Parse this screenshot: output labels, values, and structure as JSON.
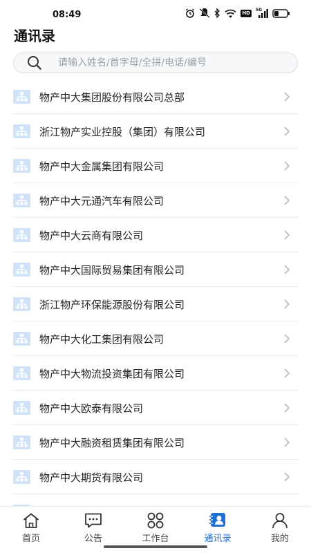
{
  "status_bar": {
    "time": "08:49",
    "hd_label": "HD",
    "signal_label": "5G",
    "icons": [
      "alarm-icon",
      "mute-icon",
      "bluetooth-icon",
      "wifi-icon",
      "hd-icon",
      "signal-icon",
      "battery-icon"
    ]
  },
  "page": {
    "title": "通讯录"
  },
  "search": {
    "placeholder": "请输入姓名/首字母/全拼/电话/编号"
  },
  "organizations": [
    {
      "label": "物产中大集团股份有限公司总部"
    },
    {
      "label": "浙江物产实业控股（集团）有限公司"
    },
    {
      "label": "物产中大金属集团有限公司"
    },
    {
      "label": "物产中大元通汽车有限公司"
    },
    {
      "label": "物产中大云商有限公司"
    },
    {
      "label": "物产中大国际贸易集团有限公司"
    },
    {
      "label": "浙江物产环保能源股份有限公司"
    },
    {
      "label": "物产中大化工集团有限公司"
    },
    {
      "label": "物产中大物流投资集团有限公司"
    },
    {
      "label": "物产中大欧泰有限公司"
    },
    {
      "label": "物产中大融资租赁集团有限公司"
    },
    {
      "label": "物产中大期货有限公司"
    },
    {
      "label": ""
    }
  ],
  "tabs": [
    {
      "label": "首页",
      "icon": "home-icon",
      "active": false
    },
    {
      "label": "公告",
      "icon": "chat-icon",
      "active": false
    },
    {
      "label": "工作台",
      "icon": "workbench-icon",
      "active": false
    },
    {
      "label": "通讯录",
      "icon": "contacts-icon",
      "active": true
    },
    {
      "label": "我的",
      "icon": "profile-icon",
      "active": false
    }
  ],
  "colors": {
    "accent": "#1f6fd6",
    "org_icon_bg": "#cfe2f8",
    "org_icon_fg": "#ffffff",
    "chevron": "#b5b8bd",
    "divider": "#ececec"
  }
}
